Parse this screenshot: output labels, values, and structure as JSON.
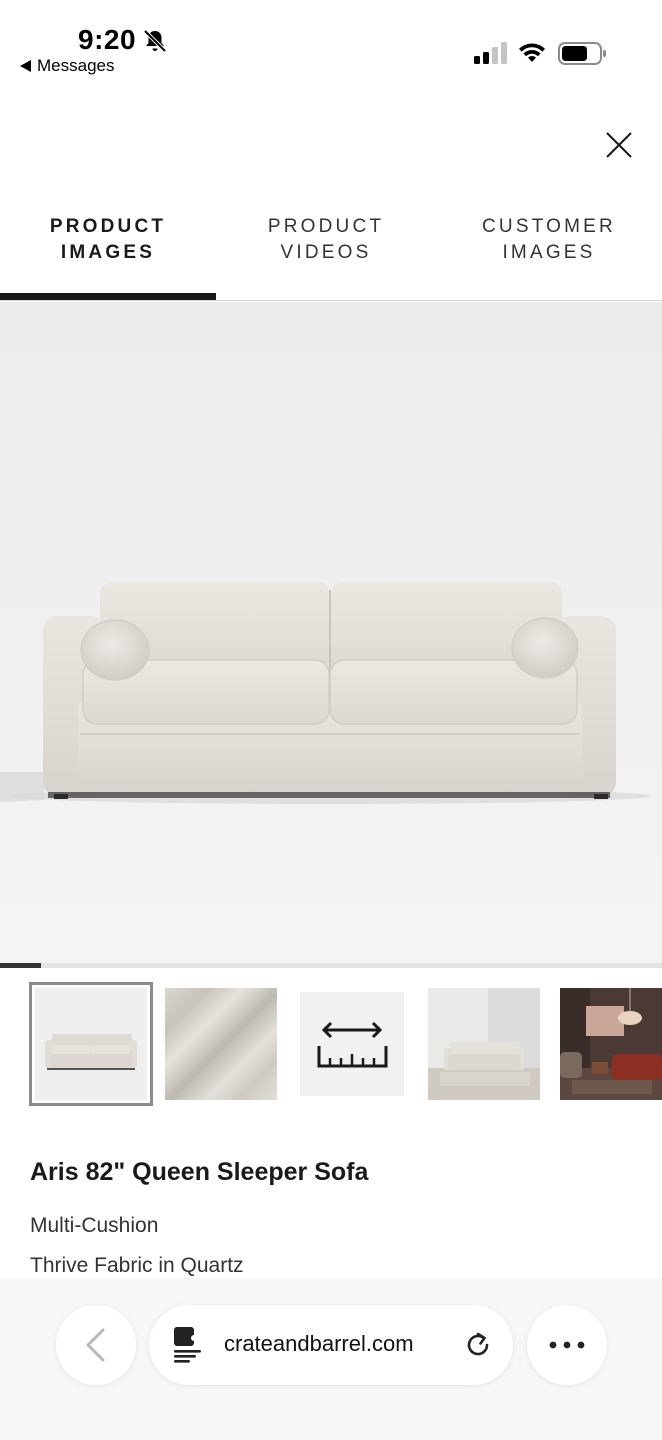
{
  "status_bar": {
    "time": "9:20",
    "back_app": "Messages",
    "icons": [
      "bell-slash-icon",
      "cellular-signal-icon",
      "wifi-icon",
      "battery-icon"
    ]
  },
  "modal": {
    "close_icon": "close-icon"
  },
  "tabs": [
    {
      "label": "PRODUCT\nIMAGES",
      "active": true
    },
    {
      "label": "PRODUCT\nVIDEOS",
      "active": false
    },
    {
      "label": "CUSTOMER\nIMAGES",
      "active": false
    }
  ],
  "gallery": {
    "progress_fraction": 0.0625,
    "thumbnails": [
      {
        "subject": "sofa front view",
        "selected": true
      },
      {
        "subject": "fabric swatch",
        "selected": false
      },
      {
        "subject": "dimensions ruler icon",
        "selected": false
      },
      {
        "subject": "sofa in room",
        "selected": false
      },
      {
        "subject": "styled living room",
        "selected": false
      }
    ]
  },
  "product": {
    "title": "Aris 82\" Queen Sleeper Sofa",
    "option": "Multi-Cushion",
    "fabric": "Thrive Fabric in Quartz"
  },
  "browser": {
    "url": "crateandbarrel.com",
    "icons": [
      "back-chevron-icon",
      "page-settings-icon",
      "reload-icon",
      "more-icon"
    ]
  },
  "colors": {
    "accent": "#1a1a1a",
    "sofa": "#e6e3dd"
  }
}
